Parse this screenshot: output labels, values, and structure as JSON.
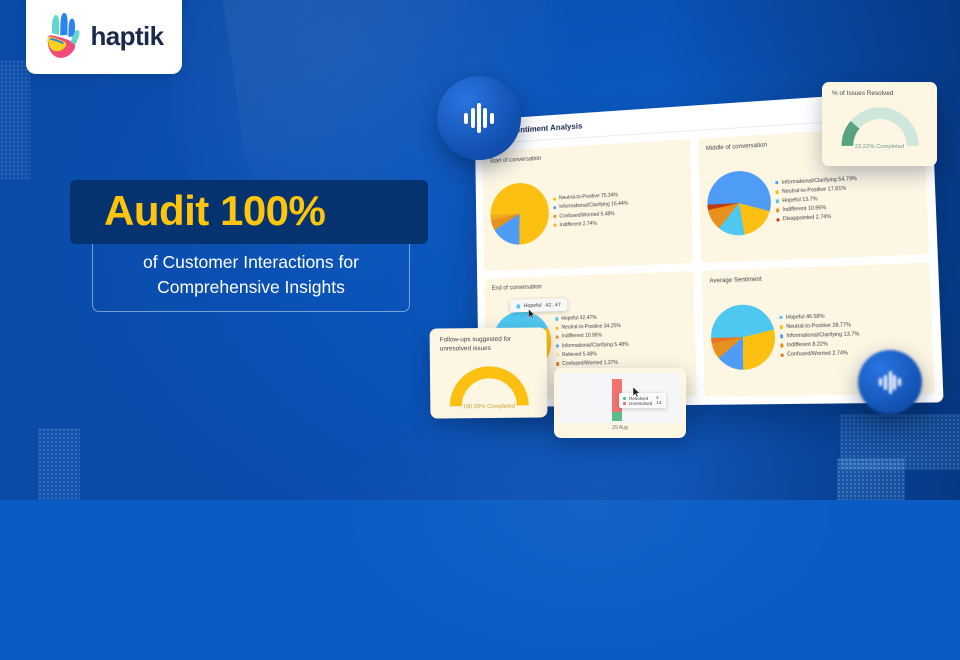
{
  "brand": {
    "name": "haptik",
    "logo_icon": "haptik-hand-logo",
    "colors": {
      "bg_blue": "#0a55bb",
      "deep_navy": "#05336f",
      "accent_yellow": "#ffc50d",
      "card_cream": "#fdf6e3"
    }
  },
  "headline": {
    "emphasis": "Audit 100%",
    "sub_line1": "of Customer Interactions for",
    "sub_line2": "Comprehensive Insights"
  },
  "dashboard": {
    "title": "Sentiment Analysis",
    "pie_tooltip": {
      "label": "Hopeful",
      "value": "42.47"
    }
  },
  "chart_data": [
    {
      "type": "pie",
      "title": "Start of conversation",
      "categories": [
        "Neutral-to-Positive",
        "Informational/Clarifying",
        "Confused/Worried",
        "Indifferent"
      ],
      "values": [
        75.34,
        16.44,
        5.48,
        2.74
      ],
      "colors": [
        "#fcc012",
        "#4e9cf5",
        "#e8901e",
        "#f0a91c"
      ],
      "legend": [
        "Neutral-to-Positive 75.34%",
        "Informational/Clarifying 16.44%",
        "Confused/Worried 5.48%",
        "Indifferent 2.74%"
      ],
      "legend_position": "right"
    },
    {
      "type": "pie",
      "title": "Middle of conversation",
      "categories": [
        "Informational/Clarifying",
        "Neutral-to-Positive",
        "Hopeful",
        "Indifferent",
        "Disappointed"
      ],
      "values": [
        54.79,
        17.81,
        13.7,
        10.96,
        2.74
      ],
      "colors": [
        "#4e9cf5",
        "#fcc012",
        "#4ec8f0",
        "#e8901e",
        "#c0390f"
      ],
      "legend": [
        "Informational/Clarifying 54.79%",
        "Neutral-to-Positive 17.81%",
        "Hopeful 13.7%",
        "Indifferent 10.96%",
        "Disappointed 2.74%"
      ],
      "legend_position": "right"
    },
    {
      "type": "pie",
      "title": "End of conversation",
      "categories": [
        "Hopeful",
        "Neutral-to-Positive",
        "Indifferent",
        "Informational/Clarifying",
        "Relieved",
        "Confused/Worried"
      ],
      "values": [
        42.47,
        34.25,
        10.96,
        5.48,
        5.48,
        1.37
      ],
      "colors": [
        "#4ec8f0",
        "#fcc012",
        "#e8901e",
        "#4e9cf5",
        "#fbe08a",
        "#e8721e"
      ],
      "legend": [
        "Hopeful 42.47%",
        "Neutral-to-Positive 34.25%",
        "Indifferent 10.96%",
        "Informational/Clarifying 5.48%",
        "Relieved 5.48%",
        "Confused/Worried 1.37%"
      ],
      "legend_position": "right"
    },
    {
      "type": "pie",
      "title": "Average Sentiment",
      "categories": [
        "Hopeful",
        "Neutral-to-Positive",
        "Informational/Clarifying",
        "Indifferent",
        "Confused/Worried"
      ],
      "values": [
        46.58,
        28.77,
        13.7,
        8.22,
        2.74
      ],
      "colors": [
        "#4ec8f0",
        "#fcc012",
        "#4e9cf5",
        "#e8901e",
        "#e8721e"
      ],
      "legend": [
        "Hopeful 46.58%",
        "Neutral-to-Positive 28.77%",
        "Informational/Clarifying 13.7%",
        "Indifferent 8.22%",
        "Confused/Worried 2.74%"
      ],
      "legend_position": "right"
    },
    {
      "type": "gauge",
      "title": "% of Issues Resolved",
      "value": 22.22,
      "caption": "22.22% Completed",
      "arc_color": "#5aa382",
      "track_color": "#cfe6dc"
    },
    {
      "type": "gauge",
      "title": "Follow-ups suggested for unresolved issues",
      "value": 100.0,
      "caption": "100.00% Completed",
      "arc_color": "#fcc012",
      "track_color": "#fbe7a4"
    },
    {
      "type": "bar",
      "title": "",
      "categories": [
        "29 Aug"
      ],
      "series": [
        {
          "name": "Resolved",
          "values": [
            4
          ],
          "color": "#5cbf8a"
        },
        {
          "name": "Unresolved",
          "values": [
            14
          ],
          "color": "#f2736f"
        }
      ],
      "xlabel": "29 Aug",
      "tooltip": [
        {
          "name": "Resolved",
          "value": "4"
        },
        {
          "name": "Unresolved",
          "value": "14"
        }
      ]
    }
  ],
  "decor": {
    "wave_badge_main": "audio-waveform-icon",
    "wave_badge_small": "audio-waveform-icon"
  }
}
